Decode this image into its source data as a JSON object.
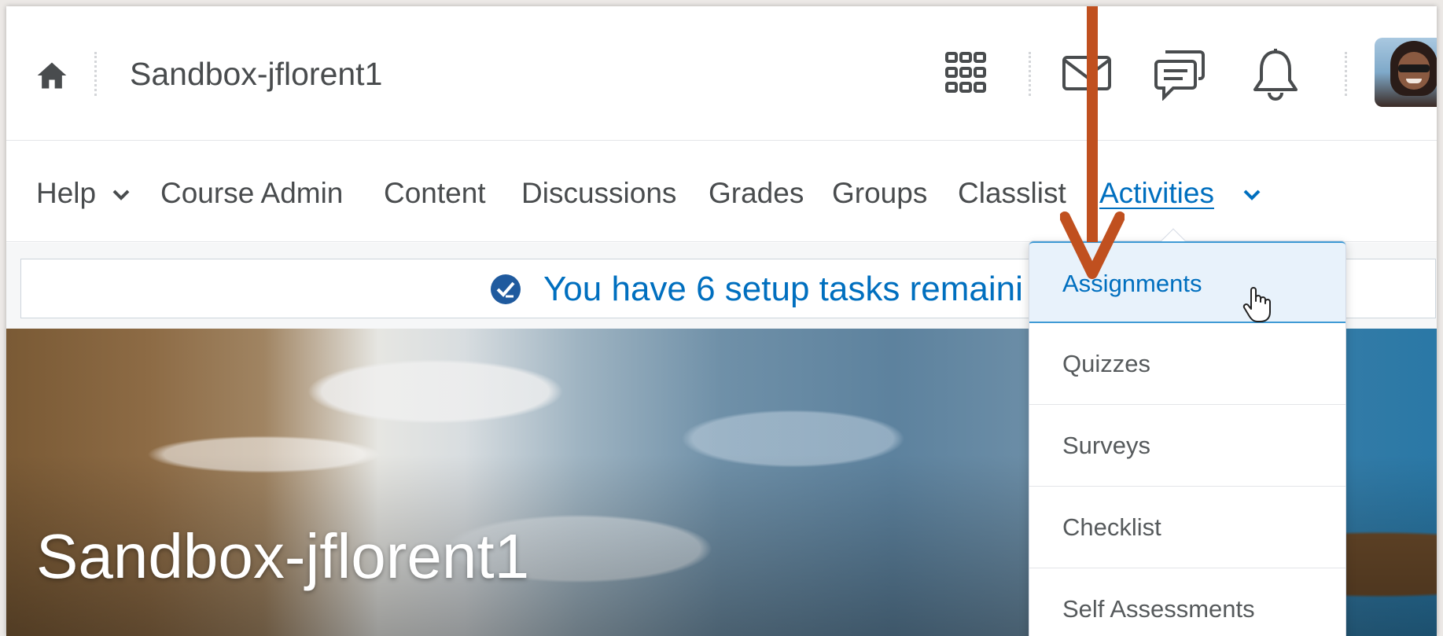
{
  "header": {
    "course_title": "Sandbox-jflorent1",
    "icons": [
      "home-icon",
      "waffle-grid-icon",
      "mail-icon",
      "chat-icon",
      "bell-icon"
    ]
  },
  "nav": {
    "items": [
      {
        "label": "Help",
        "has_dropdown": true
      },
      {
        "label": "Course Admin"
      },
      {
        "label": "Content"
      },
      {
        "label": "Discussions"
      },
      {
        "label": "Grades"
      },
      {
        "label": "Groups"
      },
      {
        "label": "Classlist"
      },
      {
        "label": "Activities",
        "has_dropdown": true,
        "active": true
      }
    ]
  },
  "banner": {
    "text": "You have 6 setup tasks remaini"
  },
  "hero": {
    "title": "Sandbox-jflorent1"
  },
  "dropdown": {
    "items": [
      {
        "label": "Assignments",
        "selected": true
      },
      {
        "label": "Quizzes"
      },
      {
        "label": "Surveys"
      },
      {
        "label": "Checklist"
      },
      {
        "label": "Self Assessments"
      }
    ]
  },
  "colors": {
    "link_blue": "#006fbf",
    "text_gray": "#494c4e",
    "selected_bg": "#e8f2fb",
    "annotation_arrow": "#c0501f"
  }
}
